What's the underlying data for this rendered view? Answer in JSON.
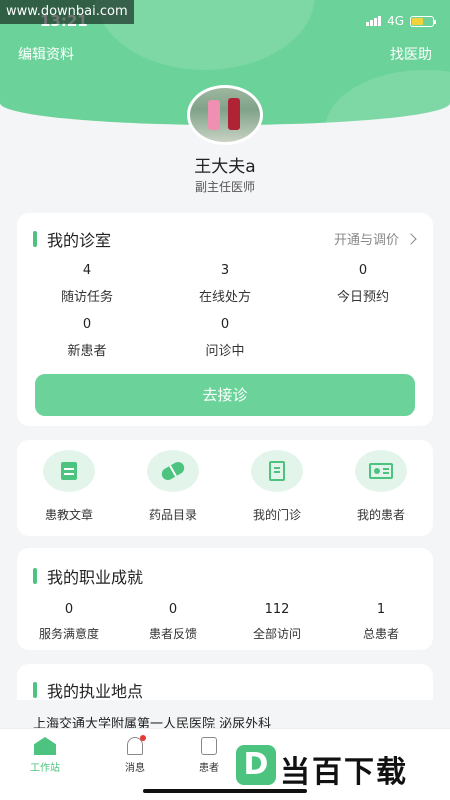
{
  "watermark": "www.downbai.com",
  "status_bar": {
    "time": "13:21",
    "network": "4G"
  },
  "header": {
    "edit_profile": "编辑资料",
    "find_help": "找医助"
  },
  "profile": {
    "name": "王大夫a",
    "title": "副主任医师"
  },
  "clinic": {
    "title": "我的诊室",
    "link_label": "开通与调价",
    "stats": [
      {
        "value": "4",
        "label": "随访任务"
      },
      {
        "value": "3",
        "label": "在线处方"
      },
      {
        "value": "0",
        "label": "今日预约"
      },
      {
        "value": "0",
        "label": "新患者"
      },
      {
        "value": "0",
        "label": "问诊中"
      }
    ],
    "button_label": "去接诊"
  },
  "tools": [
    {
      "label": "患教文章",
      "icon": "document-icon"
    },
    {
      "label": "药品目录",
      "icon": "pill-icon"
    },
    {
      "label": "我的门诊",
      "icon": "building-icon"
    },
    {
      "label": "我的患者",
      "icon": "id-card-icon"
    }
  ],
  "achievements": {
    "title": "我的职业成就",
    "stats": [
      {
        "value": "0",
        "label": "服务满意度"
      },
      {
        "value": "0",
        "label": "患者反馈"
      },
      {
        "value": "112",
        "label": "全部访问"
      },
      {
        "value": "1",
        "label": "总患者"
      }
    ]
  },
  "locations": {
    "title": "我的执业地点",
    "items": [
      "上海交通大学附属第一人民医院 泌尿外科"
    ]
  },
  "tabbar": {
    "items": [
      {
        "label": "工作站",
        "active": true
      },
      {
        "label": "消息",
        "active": false
      },
      {
        "label": "患者",
        "active": false
      }
    ]
  },
  "brand_overlay": {
    "logo_letter": "D",
    "text": "当百下载"
  },
  "colors": {
    "accent": "#4cc37f",
    "header": "#6bd39a",
    "background": "#f4f5f7"
  }
}
